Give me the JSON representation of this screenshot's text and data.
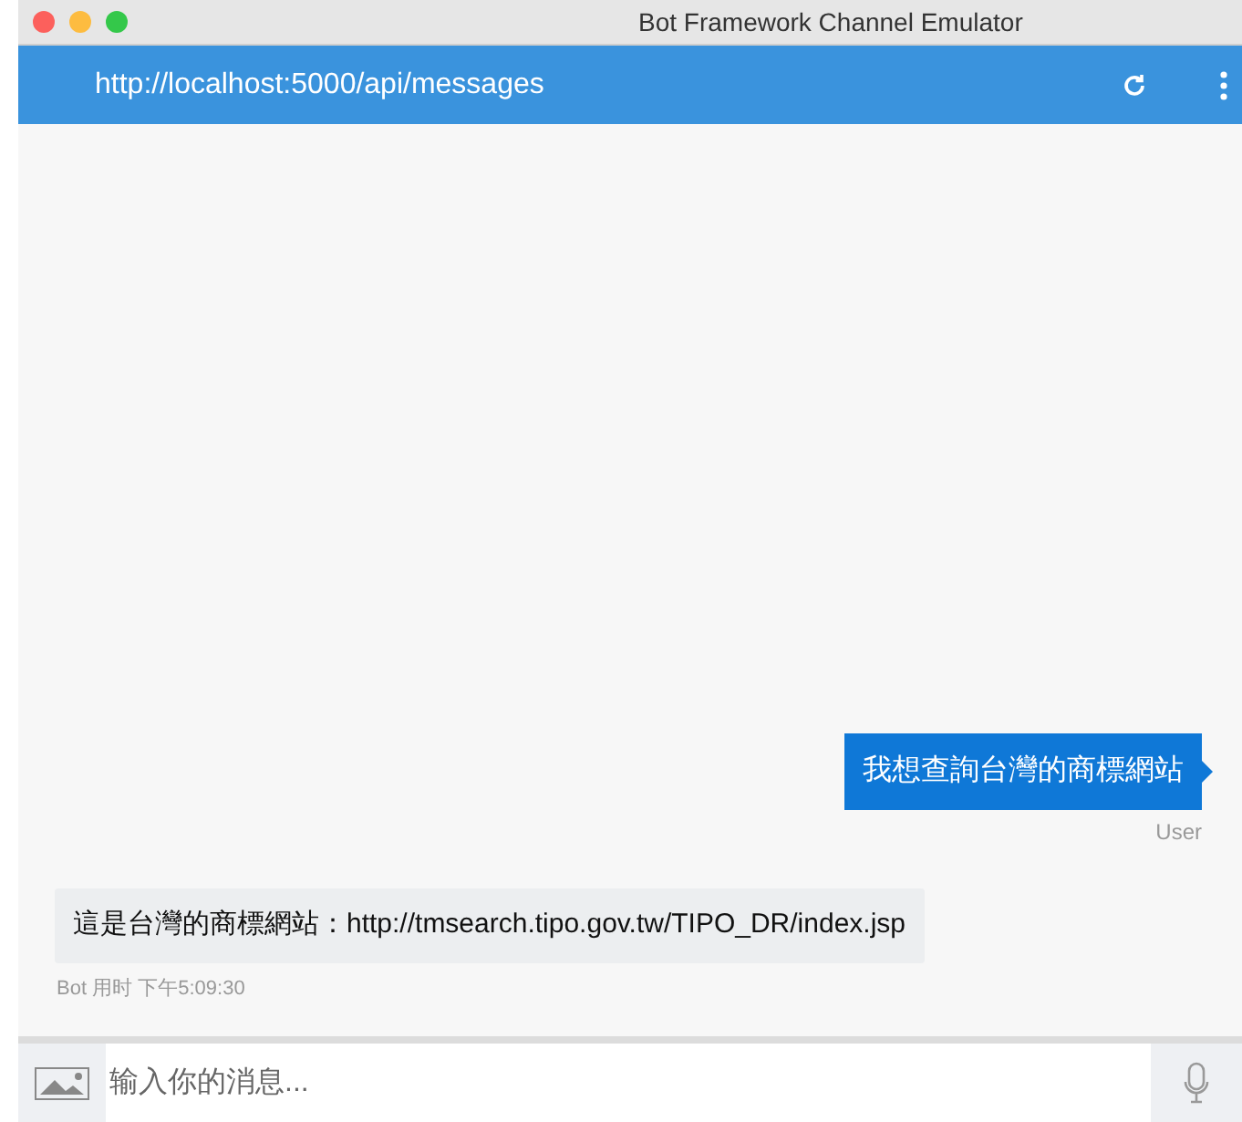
{
  "window": {
    "title": "Bot Framework Channel Emulator"
  },
  "address_bar": {
    "url": "http://localhost:5000/api/messages"
  },
  "messages": [
    {
      "kind": "user",
      "text": "我想查詢台灣的商標網站",
      "meta": "User"
    },
    {
      "kind": "bot",
      "text": "這是台灣的商標網站：http://tmsearch.tipo.gov.tw/TIPO_DR/index.jsp",
      "meta": "Bot 用时 下午5:09:30"
    }
  ],
  "composer": {
    "placeholder": "输入你的消息..."
  }
}
